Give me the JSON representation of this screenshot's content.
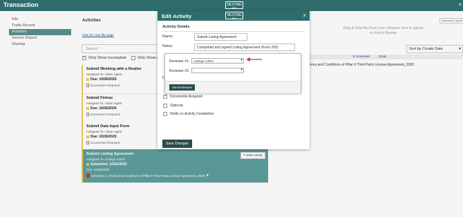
{
  "app": {
    "title": "Transaction",
    "logo_text": "NEXONE",
    "logo_sub": "aeos",
    "close_glyph": "×"
  },
  "sidebar": {
    "items": [
      {
        "label": "Info"
      },
      {
        "label": "Trade Record"
      },
      {
        "label": "Activities"
      },
      {
        "label": "Service Report"
      },
      {
        "label": "Sharing"
      }
    ]
  },
  "activities": {
    "header": "Activities",
    "howdo_link": "How do I use this page",
    "search_placeholder": "Search",
    "filter_incomplete": "Only Show Incomplete",
    "filter_assigned": "Only Show Ass",
    "cards": [
      {
        "title": "Submit Working with a Realtor",
        "assigned": "Assigned To:  Adam Agent",
        "due": "Due:  10/26/2020",
        "docs": "Documents Required"
      },
      {
        "title": "Submit Fintrac",
        "assigned": "Assigned To:  Adam Agent",
        "due": "Due:  10/26/2020",
        "docs": "Documents Required"
      },
      {
        "title": "Submit Data Input Form",
        "assigned": "Assigned To:  Adam Agent",
        "due": "Due:  10/26/2020",
        "docs": "Documents Required"
      }
    ],
    "selected": {
      "title": "Submit Listing Agreement",
      "assigned": "Assigned To:  Listings Admin",
      "submitted": "Submitted:  10/20/2020",
      "due": "Due:  10/26/2020",
      "schedule": "Schedule A_Terms and Conditions of Pillar 9 Third Party License Agreement_2020",
      "edit_label": "Edit Activity"
    }
  },
  "docs_panel": {
    "drop_line1": "Drag & Drop files from your computer here to upload",
    "drop_line2": "or click to Browse",
    "mini1": "Download",
    "mini2": "Upload",
    "sort": "Sort by Create Date",
    "download": "Download",
    "email": "Email",
    "row_text": "erms and Conditions of Pillar 9 Third Party License Agreement_2020"
  },
  "modal": {
    "title": "Edit Activity",
    "section": "Activity Details",
    "name_label": "Name",
    "name_value": "Submit Listing Agreement",
    "notes_label": "Notes",
    "notes_value": "Completed and signed Listing Agreement (Form 200)",
    "partial_label": "D",
    "options": [
      {
        "label": "Documents Required",
        "checked": true
      },
      {
        "label": "Optional",
        "checked": false
      },
      {
        "label": "Notify on Activity Completion",
        "checked": false
      }
    ],
    "save_label": "Save Changes"
  },
  "reviewers": {
    "r1_label": "Reviewer #1:",
    "r1_value": "Listings Admin",
    "r2_label": "Reviewer #2:",
    "r2_value": "",
    "set_label": "Set Reviewers"
  },
  "colors": {
    "brand": "#2f6d6d",
    "selected_card": "#5e9f9e",
    "arrow": "#c0392b"
  }
}
